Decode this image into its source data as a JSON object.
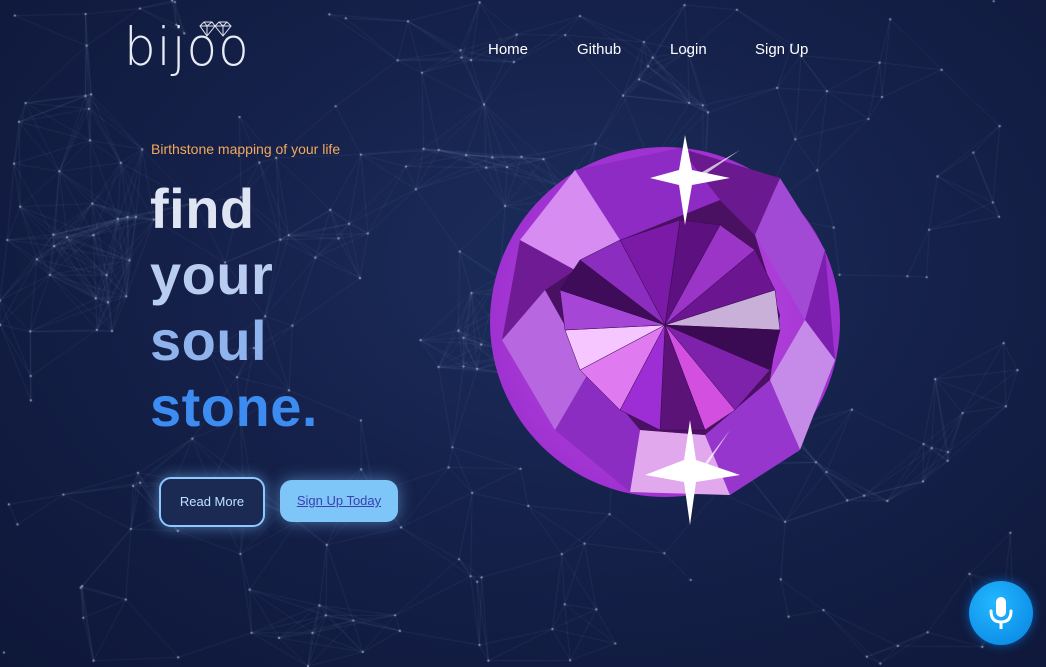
{
  "logo": {
    "text": "bijoo"
  },
  "nav": {
    "items": [
      {
        "label": "Home"
      },
      {
        "label": "Github"
      },
      {
        "label": "Login"
      },
      {
        "label": "Sign Up"
      }
    ]
  },
  "hero": {
    "tagline": "Birthstone mapping of your life",
    "lines": [
      "find",
      "your",
      "soul",
      "stone."
    ],
    "read_more": "Read More",
    "sign_up": "Sign Up Today"
  },
  "colors": {
    "accent": "#3d8cf2",
    "tagline": "#f2a95b",
    "gem": "#a830d8"
  },
  "icons": {
    "mic": "microphone-icon",
    "gem": "amethyst-gem-illustration"
  }
}
